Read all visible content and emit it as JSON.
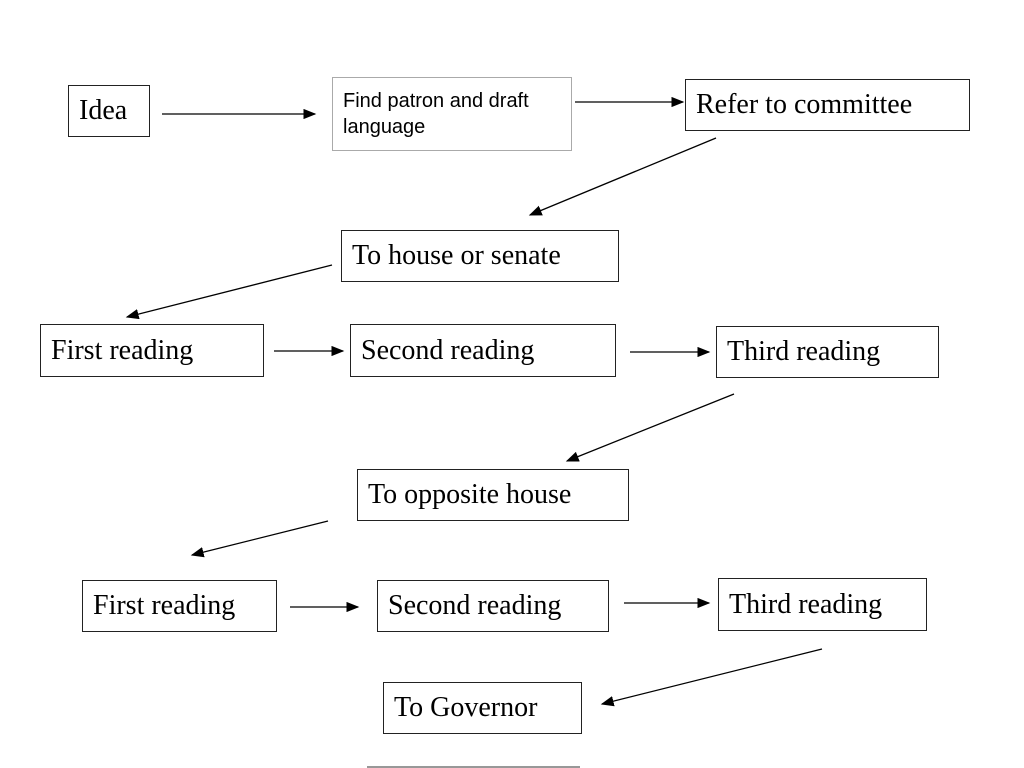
{
  "diagram": {
    "nodes": [
      {
        "id": "idea",
        "label": "Idea"
      },
      {
        "id": "patron",
        "label": "Find patron and draft language"
      },
      {
        "id": "committee",
        "label": "Refer to committee"
      },
      {
        "id": "house",
        "label": "To house or senate"
      },
      {
        "id": "first1",
        "label": "First reading"
      },
      {
        "id": "second1",
        "label": "Second reading"
      },
      {
        "id": "third1",
        "label": "Third reading"
      },
      {
        "id": "opposite",
        "label": "To opposite house"
      },
      {
        "id": "first2",
        "label": "First reading"
      },
      {
        "id": "second2",
        "label": "Second reading"
      },
      {
        "id": "third2",
        "label": "Third reading"
      },
      {
        "id": "governor",
        "label": "To Governor"
      }
    ],
    "edges": [
      {
        "from": "idea",
        "to": "patron"
      },
      {
        "from": "patron",
        "to": "committee"
      },
      {
        "from": "committee",
        "to": "house"
      },
      {
        "from": "house",
        "to": "first1"
      },
      {
        "from": "first1",
        "to": "second1"
      },
      {
        "from": "second1",
        "to": "third1"
      },
      {
        "from": "third1",
        "to": "opposite"
      },
      {
        "from": "opposite",
        "to": "first2"
      },
      {
        "from": "first2",
        "to": "second2"
      },
      {
        "from": "second2",
        "to": "third2"
      },
      {
        "from": "third2",
        "to": "governor"
      }
    ]
  }
}
